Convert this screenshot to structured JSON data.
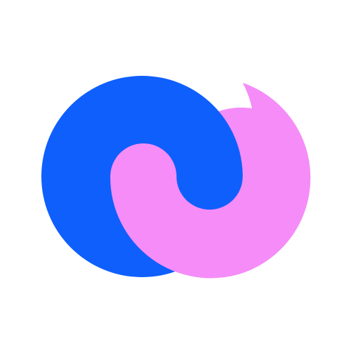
{
  "logo": {
    "icon": "interlocking-circles-logo-icon",
    "colors": {
      "background": "#ffffff",
      "blue": "#0F5FFD",
      "pink": "#F58CF8"
    }
  }
}
